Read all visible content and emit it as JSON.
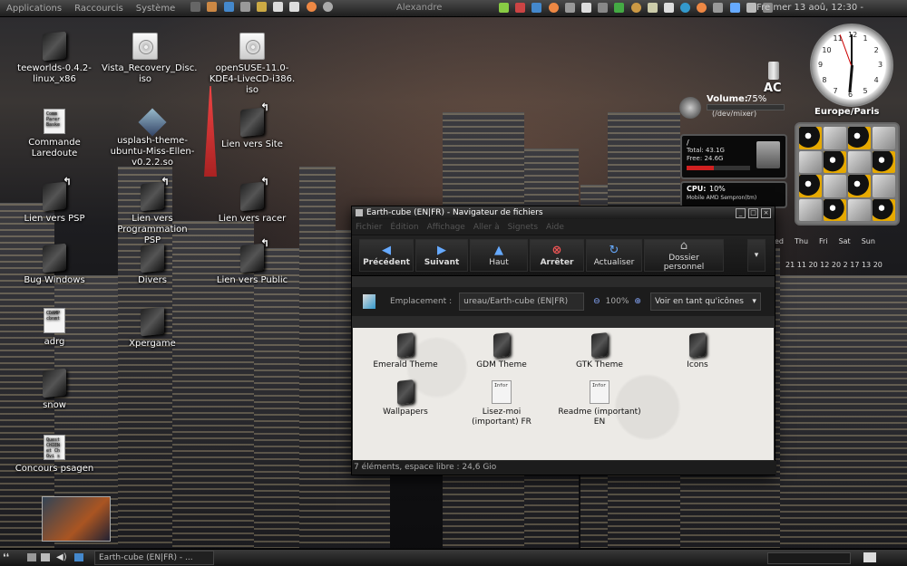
{
  "top_panel": {
    "menus": [
      "Applications",
      "Raccourcis",
      "Système"
    ],
    "user": "Alexandre",
    "clock": "Fre mer 13 aoû, 12:30 -"
  },
  "desktop_icons": [
    {
      "name": "teeworlds-0.4.2-\nlinux_x86",
      "type": "folder"
    },
    {
      "name": "Vista_Recovery_Disc.\niso",
      "type": "disc"
    },
    {
      "name": "openSUSE-11.0-\nKDE4-LiveCD-i386.\niso",
      "type": "disc"
    },
    {
      "name": "Commande\nLaredoute",
      "type": "doc",
      "preview": "Comm Parer Baske"
    },
    {
      "name": "usplash-theme-\nubuntu-Miss-Ellen-\nv0.2.2.so",
      "type": "package"
    },
    {
      "name": "Lien vers Site",
      "type": "link"
    },
    {
      "name": "Lien vers PSP",
      "type": "link"
    },
    {
      "name": "Lien vers\nProgrammation PSP",
      "type": "link"
    },
    {
      "name": "Lien vers racer",
      "type": "link"
    },
    {
      "name": "Bug Windows",
      "type": "folder"
    },
    {
      "name": "Divers",
      "type": "folder"
    },
    {
      "name": "Lien vers Public",
      "type": "link"
    },
    {
      "name": "adrg",
      "type": "doc",
      "preview": "CDAMP cbnmt"
    },
    {
      "name": "Xpergame",
      "type": "folder"
    },
    {
      "name": "snow",
      "type": "folder"
    },
    {
      "name": "Concours psagen",
      "type": "doc",
      "preview": "Quest CHIEN et Ch Ovi s"
    }
  ],
  "widgets": {
    "power": "AC",
    "volume_label": "Volume:",
    "volume_value": "75%",
    "volume_device": "(/dev/mixer)",
    "disk_mount": "/",
    "disk_total": "Total: 43.1G",
    "disk_free": "Free: 24.6G",
    "disk_used_fraction": 0.43,
    "cpu_label": "CPU:",
    "cpu_value": "10%",
    "cpu_model": "Mobile AMD Sempron(tm)",
    "timezone": "Europe/Paris",
    "clock_numbers": [
      "12",
      "1",
      "2",
      "3",
      "4",
      "5",
      "6",
      "7",
      "8",
      "9",
      "10",
      "11"
    ],
    "clock_time": "12:30",
    "calendar_days": [
      "ed",
      "Thu",
      "Fri",
      "Sat",
      "Sun"
    ],
    "calendar_dates": "21  11  20  12  20  2  17  13  20"
  },
  "window": {
    "title": "Earth-cube (EN|FR) - Navigateur de fichiers",
    "menu": [
      "Fichier",
      "Édition",
      "Affichage",
      "Aller à",
      "Signets",
      "Aide"
    ],
    "toolbar": {
      "back": "Précédent",
      "forward": "Suivant",
      "up": "Haut",
      "stop": "Arrêter",
      "reload": "Actualiser",
      "home": "Dossier personnel"
    },
    "location_label": "Emplacement :",
    "location_value": "ureau/Earth-cube (EN|FR)",
    "zoom": "100%",
    "view_mode": "Voir en tant qu'icônes",
    "items": [
      {
        "name": "Emerald Theme",
        "type": "folder"
      },
      {
        "name": "GDM Theme",
        "type": "folder"
      },
      {
        "name": "GTK Theme",
        "type": "folder"
      },
      {
        "name": "Icons",
        "type": "folder"
      },
      {
        "name": "Wallpapers",
        "type": "folder"
      },
      {
        "name": "Lisez-moi\n(important) FR",
        "type": "doc",
        "preview": "Infor"
      },
      {
        "name": "Readme (important)\nEN",
        "type": "doc",
        "preview": "Infor"
      }
    ],
    "status": "7 éléments, espace libre : 24,6 Gio"
  },
  "bottom_panel": {
    "task": "Earth-cube (EN|FR) - ..."
  },
  "colors": {
    "accent_red": "#d02020",
    "window_bg": "#2b2b2b",
    "content_bg": "#eceae6"
  }
}
